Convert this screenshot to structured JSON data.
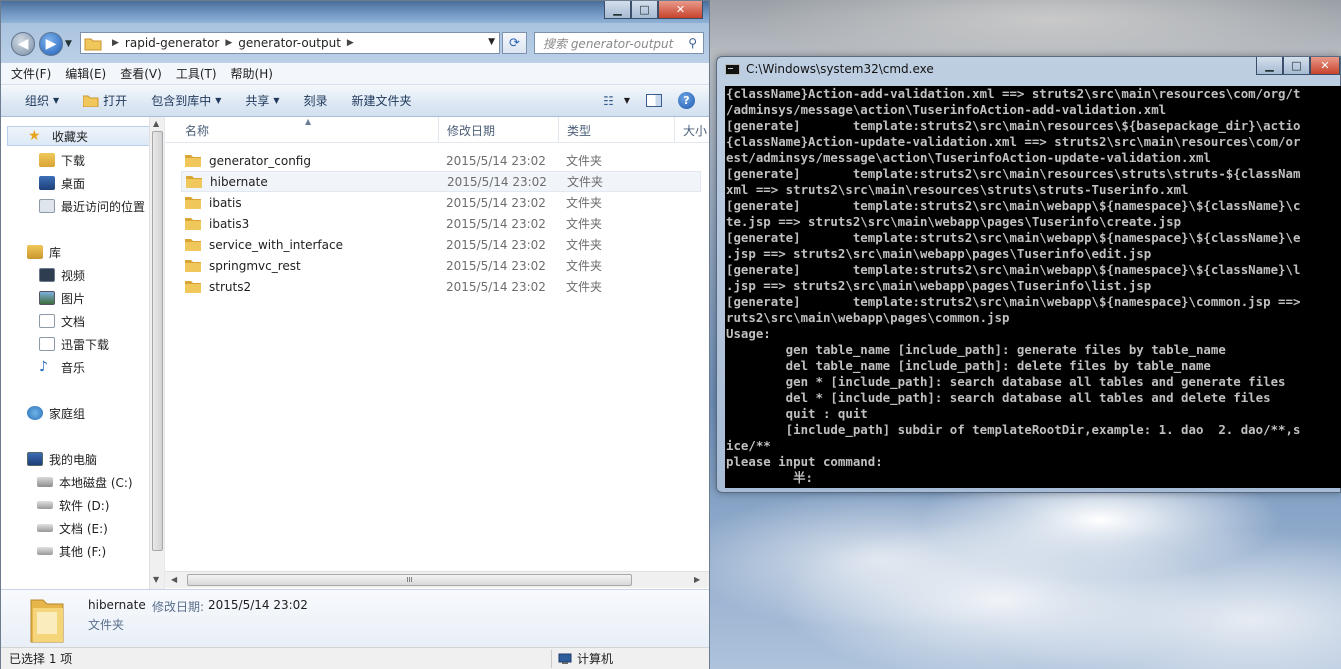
{
  "explorer": {
    "address": {
      "crumbs": [
        "rapid-generator",
        "generator-output"
      ]
    },
    "search_placeholder": "搜索 generator-output",
    "menu": [
      "文件(F)",
      "编辑(E)",
      "查看(V)",
      "工具(T)",
      "帮助(H)"
    ],
    "toolbar": {
      "organize": "组织",
      "open": "打开",
      "include_in_library": "包含到库中",
      "share": "共享",
      "burn": "刻录",
      "new_folder": "新建文件夹"
    },
    "nav": {
      "favorites": "收藏夹",
      "downloads": "下载",
      "desktop": "桌面",
      "recent": "最近访问的位置",
      "libraries": "库",
      "videos": "视频",
      "pictures": "图片",
      "documents": "文档",
      "xunlei": "迅雷下载",
      "music": "音乐",
      "homegroup": "家庭组",
      "computer": "我的电脑",
      "drive_c": "本地磁盘 (C:)",
      "drive_d": "软件 (D:)",
      "drive_e": "文档 (E:)",
      "drive_f": "其他 (F:)"
    },
    "columns": {
      "name": "名称",
      "date": "修改日期",
      "type": "类型",
      "size": "大小"
    },
    "files": [
      {
        "name": "generator_config",
        "date": "2015/5/14 23:02",
        "type": "文件夹"
      },
      {
        "name": "hibernate",
        "date": "2015/5/14 23:02",
        "type": "文件夹"
      },
      {
        "name": "ibatis",
        "date": "2015/5/14 23:02",
        "type": "文件夹"
      },
      {
        "name": "ibatis3",
        "date": "2015/5/14 23:02",
        "type": "文件夹"
      },
      {
        "name": "service_with_interface",
        "date": "2015/5/14 23:02",
        "type": "文件夹"
      },
      {
        "name": "springmvc_rest",
        "date": "2015/5/14 23:02",
        "type": "文件夹"
      },
      {
        "name": "struts2",
        "date": "2015/5/14 23:02",
        "type": "文件夹"
      }
    ],
    "hscroll_grip": "III",
    "details": {
      "name": "hibernate",
      "date_label": "修改日期:",
      "date": "2015/5/14 23:02",
      "type": "文件夹"
    },
    "status": {
      "selection": "已选择 1 项",
      "location": "计算机"
    }
  },
  "cmd": {
    "title": "C:\\Windows\\system32\\cmd.exe",
    "lines": [
      "{className}Action-add-validation.xml ==> struts2\\src\\main\\resources\\com/org/t",
      "/adminsys/message\\action\\TuserinfoAction-add-validation.xml",
      "[generate]       template:struts2\\src\\main\\resources\\${basepackage_dir}\\actio",
      "{className}Action-update-validation.xml ==> struts2\\src\\main\\resources\\com/or",
      "est/adminsys/message\\action\\TuserinfoAction-update-validation.xml",
      "[generate]       template:struts2\\src\\main\\resources\\struts\\struts-${classNam",
      "xml ==> struts2\\src\\main\\resources\\struts\\struts-Tuserinfo.xml",
      "[generate]       template:struts2\\src\\main\\webapp\\${namespace}\\${className}\\c",
      "te.jsp ==> struts2\\src\\main\\webapp\\pages\\Tuserinfo\\create.jsp",
      "[generate]       template:struts2\\src\\main\\webapp\\${namespace}\\${className}\\e",
      ".jsp ==> struts2\\src\\main\\webapp\\pages\\Tuserinfo\\edit.jsp",
      "[generate]       template:struts2\\src\\main\\webapp\\${namespace}\\${className}\\l",
      ".jsp ==> struts2\\src\\main\\webapp\\pages\\Tuserinfo\\list.jsp",
      "[generate]       template:struts2\\src\\main\\webapp\\${namespace}\\common.jsp ==>",
      "ruts2\\src\\main\\webapp\\pages\\common.jsp",
      "Usage:",
      "        gen table_name [include_path]: generate files by table_name",
      "        del table_name [include_path]: delete files by table_name",
      "        gen * [include_path]: search database all tables and generate files",
      "        del * [include_path]: search database all tables and delete files",
      "        quit : quit",
      "        [include_path] subdir of templateRootDir,example: 1. dao  2. dao/**,s",
      "ice/**",
      "please input command:",
      "         半:"
    ]
  },
  "colors": {
    "folder": "#f0c75a",
    "folder_dark": "#d9a535",
    "console_bg": "#000000",
    "console_fg": "#c0c0c0"
  }
}
